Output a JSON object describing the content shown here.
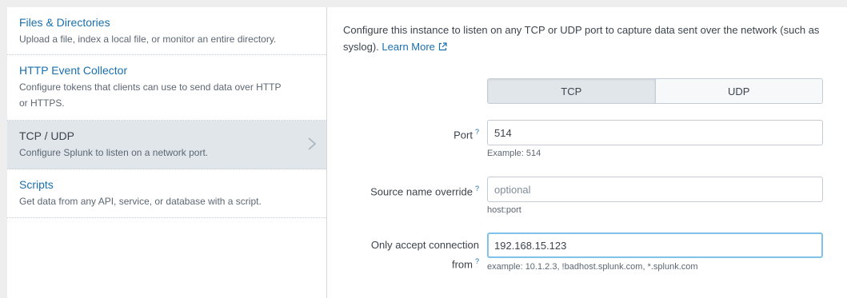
{
  "sidebar": {
    "items": [
      {
        "title": "Files & Directories",
        "desc": "Upload a file, index a local file, or monitor an entire directory."
      },
      {
        "title": "HTTP Event Collector",
        "desc": "Configure tokens that clients can use to send data over HTTP or HTTPS."
      },
      {
        "title": "TCP / UDP",
        "desc": "Configure Splunk to listen on a network port."
      },
      {
        "title": "Scripts",
        "desc": "Get data from any API, service, or database with a script."
      }
    ]
  },
  "main": {
    "intro": "Configure this instance to listen on any TCP or UDP port to capture data sent over the network (such as syslog).",
    "learn_more": "Learn More",
    "protocol": {
      "tcp": "TCP",
      "udp": "UDP",
      "selected": "TCP"
    },
    "port": {
      "label": "Port",
      "value": "514",
      "help": "Example: 514",
      "q": "?"
    },
    "source": {
      "label": "Source name override",
      "placeholder": "optional",
      "help": "host:port",
      "q": "?"
    },
    "accept": {
      "label": "Only accept connection from",
      "value": "192.168.15.123",
      "help": "example: 10.1.2.3, !badhost.splunk.com, *.splunk.com",
      "q": "?"
    }
  },
  "icons": {
    "chevron": "chevron-right-icon",
    "external": "external-link-icon"
  },
  "colors": {
    "link": "#1a6fad",
    "active_bg": "#e1e6eb",
    "focus": "#7fc2ea"
  }
}
